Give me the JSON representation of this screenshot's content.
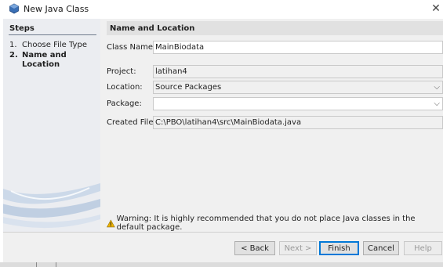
{
  "window": {
    "title": "New Java Class",
    "close_glyph": "✕"
  },
  "steps": {
    "title": "Steps",
    "items": [
      {
        "num": "1.",
        "label": "Choose File Type",
        "active": false
      },
      {
        "num": "2.",
        "label_line1": "Name and",
        "label_line2": "Location",
        "active": true
      }
    ]
  },
  "section": {
    "title": "Name and Location"
  },
  "form": {
    "class_name": {
      "label": "Class Name:",
      "value": "MainBiodata"
    },
    "project": {
      "label": "Project:",
      "value": "latihan4"
    },
    "location": {
      "label": "Location:",
      "value": "Source Packages"
    },
    "package": {
      "label": "Package:",
      "value": ""
    },
    "created_file": {
      "label": "Created File:",
      "value": "C:\\PBO\\latihan4\\src\\MainBiodata.java"
    }
  },
  "warning": {
    "text": "Warning: It is highly recommended that you do not place Java classes in the default package.",
    "icon": "warning-icon"
  },
  "buttons": {
    "back": "< Back",
    "next": "Next >",
    "finish": "Finish",
    "cancel": "Cancel",
    "help": "Help"
  },
  "colors": {
    "accent": "#0078d7",
    "warning": "#f0b400"
  }
}
